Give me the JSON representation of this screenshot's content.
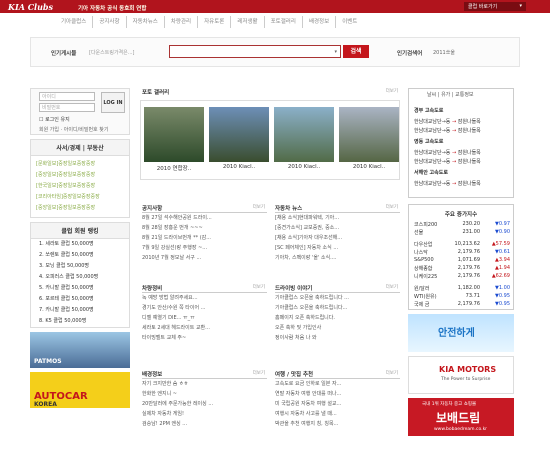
{
  "header": {
    "logo": "KIA Clubs",
    "subtitle": "기아 자동차 공식 동호회 연합",
    "club_go": "클럽 바로가기",
    "brand_red": "#b1141d"
  },
  "nav": [
    "기아클럽스",
    "공지사항",
    "자동차뉴스",
    "차량관리",
    "자유토론",
    "레저생활",
    "포토갤러리",
    "배경정보",
    "이벤트"
  ],
  "search": {
    "popular_label": "인기게시물",
    "popular_value": "[다운스트링가격은...]",
    "button": "검색",
    "hotword_label": "인기검색어",
    "hotword_value": "2011쏘울"
  },
  "login": {
    "id_placeholder": "아이디",
    "pw_placeholder": "비밀번호",
    "button": "LOG IN",
    "save_label": "로그인 유지",
    "links": "회원 가입 · 아이디/비밀번호 찾기"
  },
  "photo_classified": {
    "title": "사서/경제 | 부동산",
    "items": [
      "[문화일보]중장일보중장중장",
      "[중앙일보]중장일보중장중장",
      "[한국일보]중장일보중장중장",
      "[코리아타임]중장일보중장중장",
      "[중앙일보]중장일보중장중장"
    ]
  },
  "club_rank": {
    "title": "클럽 회원 랭킹",
    "items": [
      "1. 세라토 클럽 50,000명",
      "2. 쏘렌토 클럽 50,000명",
      "3. 모닝 클럽 50,000명",
      "4. 오피러스 클럽 50,000명",
      "5. 카니발 클럽 50,000명",
      "6. 포르테 클럽 50,000명",
      "7. 카니발 클럽 50,000명",
      "8. K5 클럽 50,000명"
    ]
  },
  "ads": {
    "ad1": "PATMOS",
    "ad2": "AUTOCAR",
    "ad2_sub": "KOREA"
  },
  "gallery": {
    "title": "포토 갤러리",
    "more": "더보기",
    "captions": [
      "2010 연합장..",
      "2010 Kiacl..",
      "2010 Kiacl..",
      "2010 Kiacl.."
    ]
  },
  "notice": {
    "title": "공지사항",
    "more": "더보기",
    "items": [
      "8월 27일 석수해안공원 드라이...",
      "8월 28일 장흥운 번개 ~~~",
      "8월 21일 드라이브번개 ** (감...",
      "7월 9일 강실선(랑 주행장 ~...",
      "2010년 7월 정모날 서구 ..."
    ]
  },
  "car_news": {
    "title": "자동차 뉴스",
    "more": "더보기",
    "items": [
      "[채용 소식]현대파워텍, 기아...",
      "[중견가소식] 교보증권, 중소...",
      "[채용 소식]기아자 대우조선해...",
      "[SC 페어체인] 자동차 소식 ...",
      "기아차, 스펙이랑 '올' 소식...."
    ]
  },
  "vehicle": {
    "title": "차량정비",
    "more": "더보기",
    "items": [
      "녹 예방 방법 알려주세요...",
      "경기도 안산/수원 쪽 타이어 ...",
      "디젤 예열기 DIE... ㅠ_ㅠ",
      "세라토 2세대 헤드라이트 교환...",
      "타이밍벨트 교체 주~"
    ]
  },
  "drive": {
    "title": "드라이빙 이야기",
    "more": "더보기",
    "items": [
      "기아클럽스 오픈을 축하드립니다 ...",
      "기아클럽스 오픈을 축하드립니다...",
      "홈페이지 오픈 축하드립니다.",
      "오픈 축하 및 가입인사",
      "정이사람 처음 나 와"
    ]
  },
  "background": {
    "title": "배경정보",
    "more": "더보기",
    "items": [
      "자기 크지만한 숨 ㅎㅎ",
      "한화한 엔지니 ~",
      "20만달러에 주문가능한 레이싱 ...",
      "실제차 자동차 게임!",
      "검승남! 2PM 엔싱 ..."
    ]
  },
  "travel": {
    "title": "여행 / 맛집 추천",
    "more": "더보기",
    "items": [
      "고속도로 요금 인하로 일본 자...",
      "연말 자동차 여행 안대를 떠나...",
      "미 국립공원 자동차 여행 설교...",
      "여행시 자동차 사고를 낼 때...",
      "박관을 추천 여행지 칭, 칭목..."
    ]
  },
  "traffic": {
    "title": "날씨 | 유가 | 교통정보",
    "roads": [
      "경부 고속도로",
      "영동 고속도로",
      "서해안 고속도로"
    ],
    "routes": [
      [
        "한남대교남단→동",
        "잠원나들목"
      ],
      [
        "한남대교남단→동",
        "잠원나들목"
      ],
      [
        "한남대교남단→동",
        "잠원나들목"
      ],
      [
        "한남대교남단→동",
        "잠원나들목"
      ],
      [
        "한남대교남단→동",
        "잠원나들목"
      ]
    ]
  },
  "stocks": {
    "title": "주요 증가지수",
    "rows": [
      {
        "name": "코스피200",
        "value": "230.20",
        "change": "▼0.97",
        "dir": "down"
      },
      {
        "name": "선물",
        "value": "231.00",
        "change": "▼0.90",
        "dir": "down"
      },
      {
        "name": "다우산업",
        "value": "10,213.62",
        "change": "▲57.59",
        "dir": "up"
      },
      {
        "name": "나스닥",
        "value": "2,179.76",
        "change": "▼0.61",
        "dir": "down"
      },
      {
        "name": "S&P500",
        "value": "1,071.69",
        "change": "▲3.94",
        "dir": "up"
      },
      {
        "name": "상해종합",
        "value": "2,179.76",
        "change": "▲1.94",
        "dir": "up"
      },
      {
        "name": "니케이225",
        "value": "2,179.76",
        "change": "▲62.69",
        "dir": "up"
      },
      {
        "name": "원/달러",
        "value": "1,182.00",
        "change": "▼1.00",
        "dir": "down"
      },
      {
        "name": "WTI(원유)",
        "value": "73.71",
        "change": "▼0.95",
        "dir": "down"
      },
      {
        "name": "국제 금",
        "value": "2,179.76",
        "change": "▼0.95",
        "dir": "down"
      }
    ]
  },
  "banners": {
    "b1": "안전하게",
    "b2_brand": "KIA MOTORS",
    "b2_sub": "The Power to Surprise",
    "b3_top": "국내 1위 자동차 중고 쇼핑몰",
    "b3_main": "보배드림",
    "b3_url": "www.bobaedream.co.kr"
  }
}
